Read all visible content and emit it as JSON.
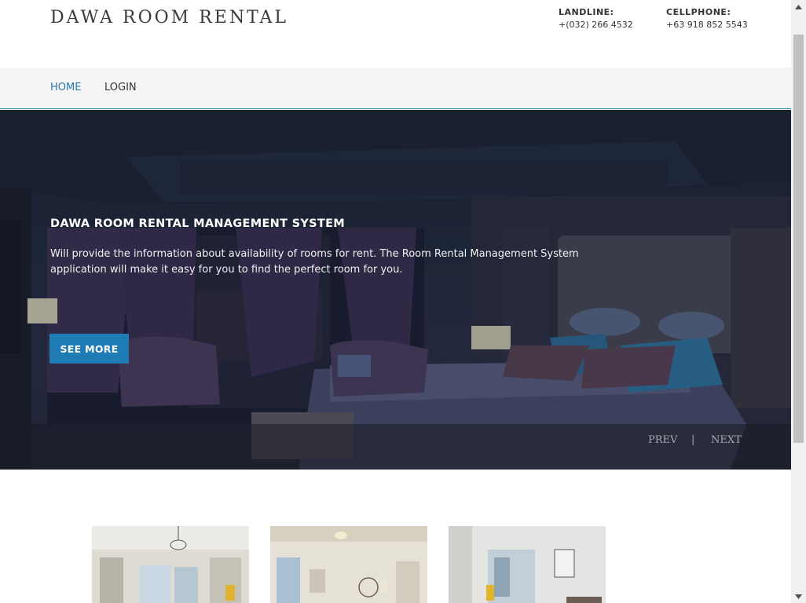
{
  "header": {
    "site_title": "DAWA ROOM RENTAL",
    "landline_label": "LANDLINE:",
    "landline_value": "+(032) 266 4532",
    "cellphone_label": "CELLPHONE:",
    "cellphone_value": "+63 918 852 5543"
  },
  "nav": {
    "items": [
      {
        "label": "HOME",
        "active": true
      },
      {
        "label": "LOGIN",
        "active": false
      }
    ]
  },
  "hero": {
    "title": "DAWA ROOM RENTAL MANAGEMENT SYSTEM",
    "description": "Will provide the information about availability of rooms for rent. The Room Rental Management System application will make it easy for you to find the perfect room for you.",
    "button_label": "SEE MORE",
    "prev_label": "PREV",
    "separator": "|",
    "next_label": "NEXT"
  },
  "colors": {
    "accent": "#1f7bb3",
    "nav_active": "#2b7bb0",
    "nav_bg": "#f5f5f5"
  },
  "icons": {
    "scroll_up": "chevron-up-icon",
    "scroll_down": "chevron-down-icon"
  }
}
